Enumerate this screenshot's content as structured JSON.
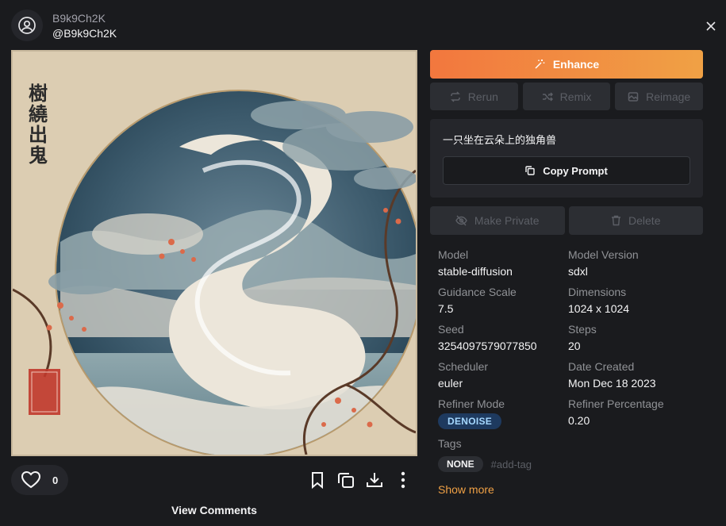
{
  "user": {
    "username": "B9k9Ch2K",
    "handle": "@B9k9Ch2K"
  },
  "image": {
    "seal_text": "",
    "calligraphy": "樹 繞 出 鬼"
  },
  "actions": {
    "like_count": "0",
    "view_comments": "View Comments"
  },
  "panel": {
    "enhance_label": "Enhance",
    "rerun_label": "Rerun",
    "remix_label": "Remix",
    "reimage_label": "Reimage",
    "prompt": "一只坐在云朵上的独角兽",
    "copy_prompt_label": "Copy Prompt",
    "make_private_label": "Make Private",
    "delete_label": "Delete"
  },
  "details": [
    {
      "label": "Model",
      "value": "stable-diffusion"
    },
    {
      "label": "Model Version",
      "value": "sdxl"
    },
    {
      "label": "Guidance Scale",
      "value": "7.5"
    },
    {
      "label": "Dimensions",
      "value": "1024 x 1024"
    },
    {
      "label": "Seed",
      "value": "3254097579077850"
    },
    {
      "label": "Steps",
      "value": "20"
    },
    {
      "label": "Scheduler",
      "value": "euler"
    },
    {
      "label": "Date Created",
      "value": "Mon Dec 18 2023"
    },
    {
      "label": "Refiner Mode",
      "value": "DENOISE"
    },
    {
      "label": "Refiner Percentage",
      "value": "0.20"
    }
  ],
  "tags": {
    "label": "Tags",
    "none_tag": "NONE",
    "add_tag_placeholder": "#add-tag"
  },
  "show_more": "Show more",
  "colors": {
    "background": "#1a1b1e",
    "accent_start": "#f2773e",
    "accent_end": "#f0a145",
    "link": "#f0a145"
  }
}
